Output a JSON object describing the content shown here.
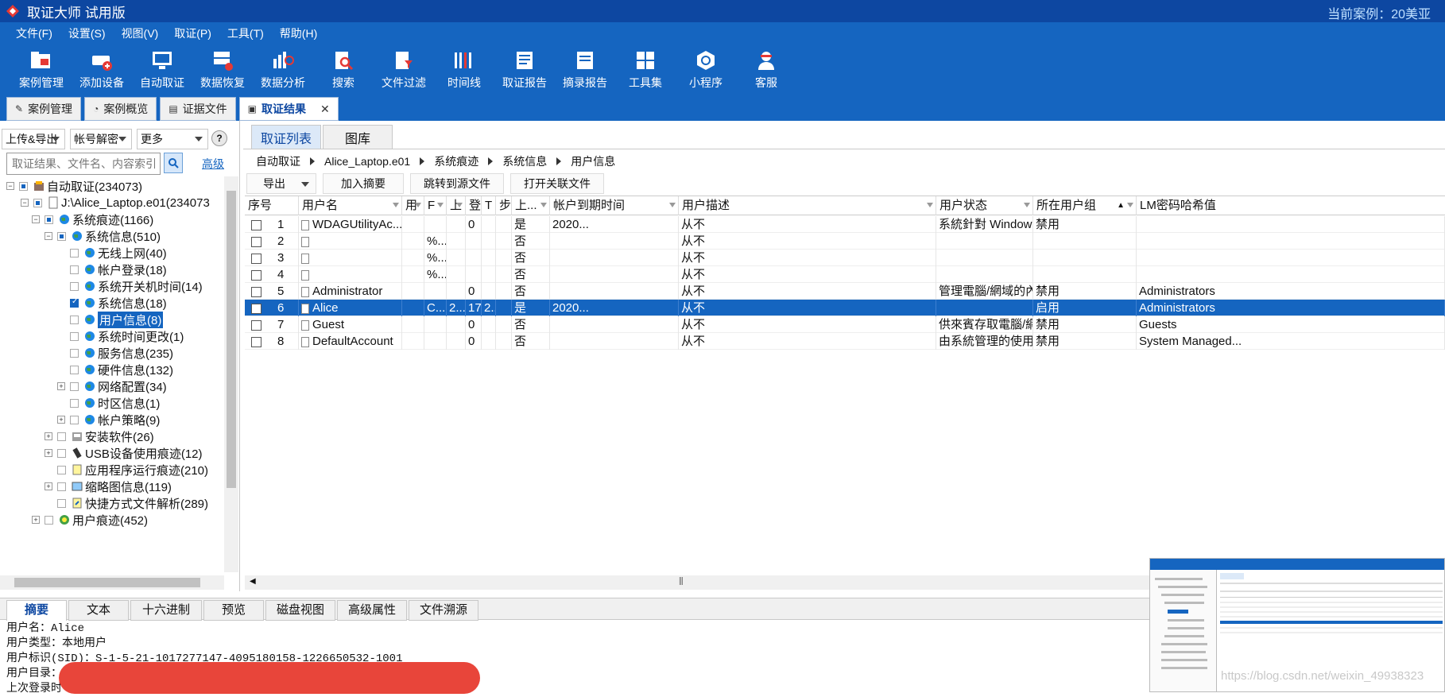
{
  "app": {
    "title": "取证大师 试用版",
    "case_label": "当前案例：20美亚"
  },
  "menu": [
    "文件(F)",
    "设置(S)",
    "视图(V)",
    "取证(P)",
    "工具(T)",
    "帮助(H)"
  ],
  "toolbar": [
    "案例管理",
    "添加设备",
    "自动取证",
    "数据恢复",
    "数据分析",
    "搜索",
    "文件过滤",
    "时间线",
    "取证报告",
    "摘录报告",
    "工具集",
    "小程序",
    "客服"
  ],
  "doc_tabs": [
    "案例管理",
    "案例概览",
    "证据文件",
    "取证结果"
  ],
  "left": {
    "upload": "上传&导出",
    "decrypt": "帐号解密",
    "more": "更多",
    "help": "?",
    "search_placeholder": "取证结果、文件名、内容索引",
    "advanced": "高级"
  },
  "tree": [
    {
      "label": "自动取证(234073)"
    },
    {
      "label": "J:\\Alice_Laptop.e01(234073"
    },
    {
      "label": "系统痕迹(1166)"
    },
    {
      "label": "系统信息(510)"
    },
    {
      "label": "无线上网(40)"
    },
    {
      "label": "帐户登录(18)"
    },
    {
      "label": "系统开关机时间(14)"
    },
    {
      "label": "系统信息(18)"
    },
    {
      "label": "用户信息(8)"
    },
    {
      "label": "系统时间更改(1)"
    },
    {
      "label": "服务信息(235)"
    },
    {
      "label": "硬件信息(132)"
    },
    {
      "label": "网络配置(34)"
    },
    {
      "label": "时区信息(1)"
    },
    {
      "label": "帐户策略(9)"
    },
    {
      "label": "安装软件(26)"
    },
    {
      "label": "USB设备使用痕迹(12)"
    },
    {
      "label": "应用程序运行痕迹(210)"
    },
    {
      "label": "缩略图信息(119)"
    },
    {
      "label": "快捷方式文件解析(289)"
    },
    {
      "label": "用户痕迹(452)"
    }
  ],
  "subtabs": [
    "取证列表",
    "图库"
  ],
  "breadcrumb": [
    "自动取证",
    "Alice_Laptop.e01",
    "系统痕迹",
    "系统信息",
    "用户信息"
  ],
  "actions": [
    "导出",
    "加入摘要",
    "跳转到源文件",
    "打开关联文件"
  ],
  "columns": [
    "序号",
    "用户名",
    "用",
    "F",
    "上",
    "登",
    "T",
    "步",
    "上...",
    "帐户到期时间",
    "用户描述",
    "用户状态",
    "所在用户组",
    "LM密码哈希值"
  ],
  "rows": [
    [
      "1",
      "WDAGUtilityAc...",
      "",
      "",
      "",
      "0",
      "",
      "",
      "是",
      "2020...",
      "从不",
      "系統針對 Windows Defender 應用程式防護案例所管...",
      "禁用",
      ""
    ],
    [
      "2",
      "",
      "",
      "%...",
      "",
      "",
      "",
      "",
      "否",
      "",
      "从不",
      "",
      "",
      ""
    ],
    [
      "3",
      "",
      "",
      "%...",
      "",
      "",
      "",
      "",
      "否",
      "",
      "从不",
      "",
      "",
      ""
    ],
    [
      "4",
      "",
      "",
      "%...",
      "",
      "",
      "",
      "",
      "否",
      "",
      "从不",
      "",
      "",
      ""
    ],
    [
      "5",
      "Administrator",
      "",
      "",
      "",
      "0",
      "",
      "",
      "否",
      "",
      "从不",
      "管理電腦/網域的內建帳戶",
      "禁用",
      "Administrators"
    ],
    [
      "6",
      "Alice",
      "",
      "C...",
      "2...",
      "17",
      "2...",
      "",
      "是",
      "2020...",
      "从不",
      "",
      "启用",
      "Administrators"
    ],
    [
      "7",
      "Guest",
      "",
      "",
      "",
      "0",
      "",
      "",
      "否",
      "",
      "从不",
      "供來賓存取電腦/網域之用的內建帳戶",
      "禁用",
      "Guests"
    ],
    [
      "8",
      "DefaultAccount",
      "",
      "",
      "",
      "0",
      "",
      "",
      "否",
      "",
      "从不",
      "由系統管理的使用者帳戶。",
      "禁用",
      "System Managed..."
    ]
  ],
  "bottom_tabs": [
    "摘要",
    "文本",
    "十六进制",
    "预览",
    "磁盘视图",
    "高级属性",
    "文件溯源"
  ],
  "detail": [
    "用户名：Alice",
    "用户类型：本地用户",
    "用户标识(SID)：S-1-5-21-1017277147-4095180158-1226650532-1001",
    "用户目录：",
    "上次登录时"
  ],
  "watermark": "https://blog.csdn.net/weixin_49938323",
  "colors": {
    "title_bg": "#0d47a1",
    "bar_bg": "#1565c0",
    "selected_row": "#1565c0",
    "redaction": "#e8453a"
  }
}
